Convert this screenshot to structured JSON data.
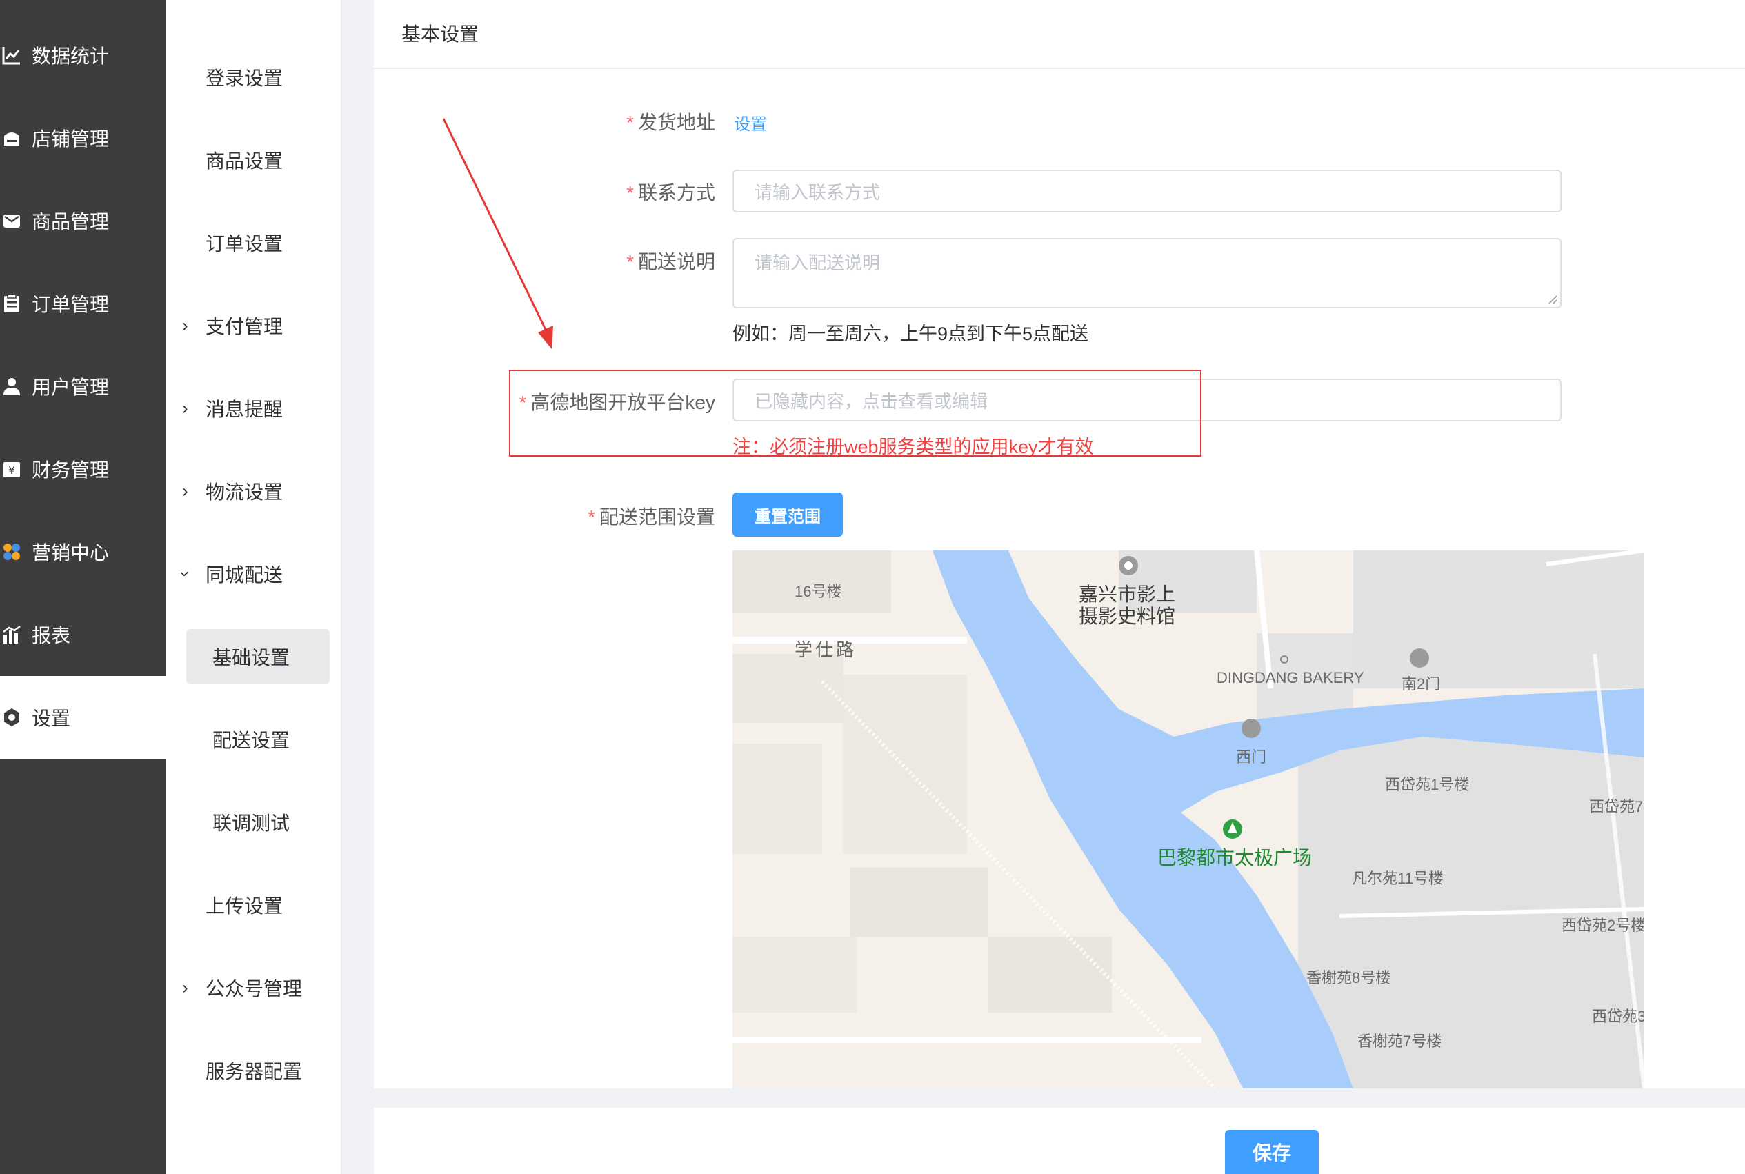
{
  "sidebar_main": {
    "items": [
      {
        "label": "数据统计",
        "icon": "chart-line-icon"
      },
      {
        "label": "店铺管理",
        "icon": "shop-icon"
      },
      {
        "label": "商品管理",
        "icon": "mail-icon"
      },
      {
        "label": "订单管理",
        "icon": "clipboard-icon"
      },
      {
        "label": "用户管理",
        "icon": "user-icon"
      },
      {
        "label": "财务管理",
        "icon": "finance-icon"
      },
      {
        "label": "营销中心",
        "icon": "marketing-icon"
      },
      {
        "label": "报表",
        "icon": "bar-chart-icon"
      },
      {
        "label": "设置",
        "icon": "gear-icon"
      }
    ],
    "active": "设置"
  },
  "sidebar_sub": {
    "items": [
      {
        "label": "登录设置"
      },
      {
        "label": "商品设置"
      },
      {
        "label": "订单设置"
      },
      {
        "label": "支付管理"
      },
      {
        "label": "消息提醒"
      },
      {
        "label": "物流设置"
      },
      {
        "label": "同城配送"
      },
      {
        "label": "基础设置"
      },
      {
        "label": "配送设置"
      },
      {
        "label": "联调测试"
      },
      {
        "label": "上传设置"
      },
      {
        "label": "公众号管理"
      },
      {
        "label": "服务器配置"
      }
    ],
    "selected": "基础设置"
  },
  "card": {
    "title": "基本设置"
  },
  "form": {
    "required_mark": "*",
    "ship_address": {
      "label": "发货地址",
      "action": "设置"
    },
    "contact": {
      "label": "联系方式",
      "placeholder": "请输入联系方式"
    },
    "delivery_desc": {
      "label": "配送说明",
      "placeholder": "请输入配送说明",
      "hint": "例如：周一至周六，上午9点到下午5点配送"
    },
    "amap_key": {
      "label": "高德地图开放平台key",
      "placeholder": "已隐藏内容，点击查看或编辑",
      "note": "注：必须注册web服务类型的应用key才有效"
    },
    "range": {
      "label": "配送范围设置",
      "button": "重置范围"
    }
  },
  "map": {
    "labels": {
      "building16": "16号楼",
      "road": "学仕路",
      "museum": "嘉兴市影上\n摄影史料馆",
      "museum_l1": "嘉兴市影上",
      "museum_l2": "摄影史料馆",
      "bakery": "DINGDANG BAKERY",
      "south_gate": "南2门",
      "west_gate": "西门",
      "xd1": "西岱苑1号楼",
      "xd7": "西岱苑7",
      "plaza": "巴黎都市太极广场",
      "fe11": "凡尔苑11号楼",
      "xd2": "西岱苑2号楼",
      "xs8": "香榭苑8号楼",
      "xd3": "西岱苑3",
      "xs7": "香榭苑7号楼"
    },
    "colors": {
      "water": "#a9cdfb",
      "land": "#f5f1ea",
      "block": "#e9e6e0",
      "green": "#1f8a2e"
    }
  },
  "footer": {
    "save": "保存"
  },
  "colors": {
    "primary": "#409eff",
    "required": "#f56c6c",
    "annotation": "#e53935",
    "sidebar": "#3d3d3d"
  }
}
